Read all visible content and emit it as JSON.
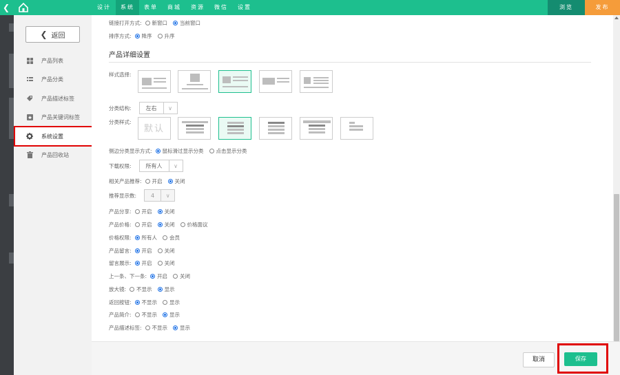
{
  "topbar": {
    "nav": [
      "设计",
      "系统",
      "表单",
      "商城",
      "资源",
      "微信",
      "设置"
    ],
    "active_nav": 1,
    "preview_label": "浏览",
    "publish_label": "发布",
    "accent_color": "#1dbf8e",
    "publish_color": "#f59c3a"
  },
  "sidebar": {
    "back_label": "返回",
    "items": [
      {
        "label": "产品列表",
        "icon": "grid-icon"
      },
      {
        "label": "产品分类",
        "icon": "list-icon"
      },
      {
        "label": "产品描述标签",
        "icon": "tag-icon"
      },
      {
        "label": "产品关键词标签",
        "icon": "star-tag-icon"
      },
      {
        "label": "系统设置",
        "icon": "gear-icon"
      },
      {
        "label": "产品回收站",
        "icon": "trash-icon"
      }
    ],
    "active_index": 4
  },
  "settings": {
    "link_open": {
      "label": "链接打开方式:",
      "options": [
        "新窗口",
        "当前窗口"
      ],
      "selected": 1
    },
    "sort": {
      "label": "排序方式:",
      "options": [
        "降序",
        "升序"
      ],
      "selected": 0
    },
    "detail_title": "产品详细设置",
    "style_select": {
      "label": "样式选择:",
      "selected": 2
    },
    "category_structure": {
      "label": "分类结构:",
      "value": "左右"
    },
    "category_style": {
      "label": "分类样式:",
      "default_text": "默认",
      "selected": 2
    },
    "side_category_display": {
      "label": "侧边分类显示方式:",
      "options": [
        "鼠标滑过显示分类",
        "点击显示分类"
      ],
      "selected": 0
    },
    "download_permission": {
      "label": "下载权限:",
      "value": "所有人"
    },
    "related_recommend": {
      "label": "相关产品推荐:",
      "options": [
        "开启",
        "关闭"
      ],
      "selected": 1
    },
    "recommend_count": {
      "label": "推荐显示数:",
      "value": "4"
    },
    "product_share": {
      "label": "产品分享:",
      "options": [
        "开启",
        "关闭"
      ],
      "selected": 1
    },
    "product_price": {
      "label": "产品价格:",
      "options": [
        "开启",
        "关闭",
        "价格面议"
      ],
      "selected": 1
    },
    "price_permission": {
      "label": "价格权限:",
      "options": [
        "所有人",
        "会员"
      ],
      "selected": 0
    },
    "product_comment": {
      "label": "产品留言:",
      "options": [
        "开启",
        "关闭"
      ],
      "selected": 0
    },
    "comment_display": {
      "label": "留言展示:",
      "options": [
        "开启",
        "关闭"
      ],
      "selected": 0
    },
    "prev_next": {
      "label": "上一条、下一条:",
      "options": [
        "开启",
        "关闭"
      ],
      "selected": 0
    },
    "magnifier": {
      "label": "放大镜:",
      "options": [
        "不显示",
        "显示"
      ],
      "selected": 1
    },
    "back_button": {
      "label": "返回按钮:",
      "options": [
        "不显示",
        "显示"
      ],
      "selected": 0
    },
    "product_intro": {
      "label": "产品简介:",
      "options": [
        "不显示",
        "显示"
      ],
      "selected": 1
    },
    "desc_tags": {
      "label": "产品描述标签:",
      "options": [
        "不显示",
        "显示"
      ],
      "selected": 1
    }
  },
  "footer": {
    "cancel_label": "取消",
    "save_label": "保存"
  }
}
